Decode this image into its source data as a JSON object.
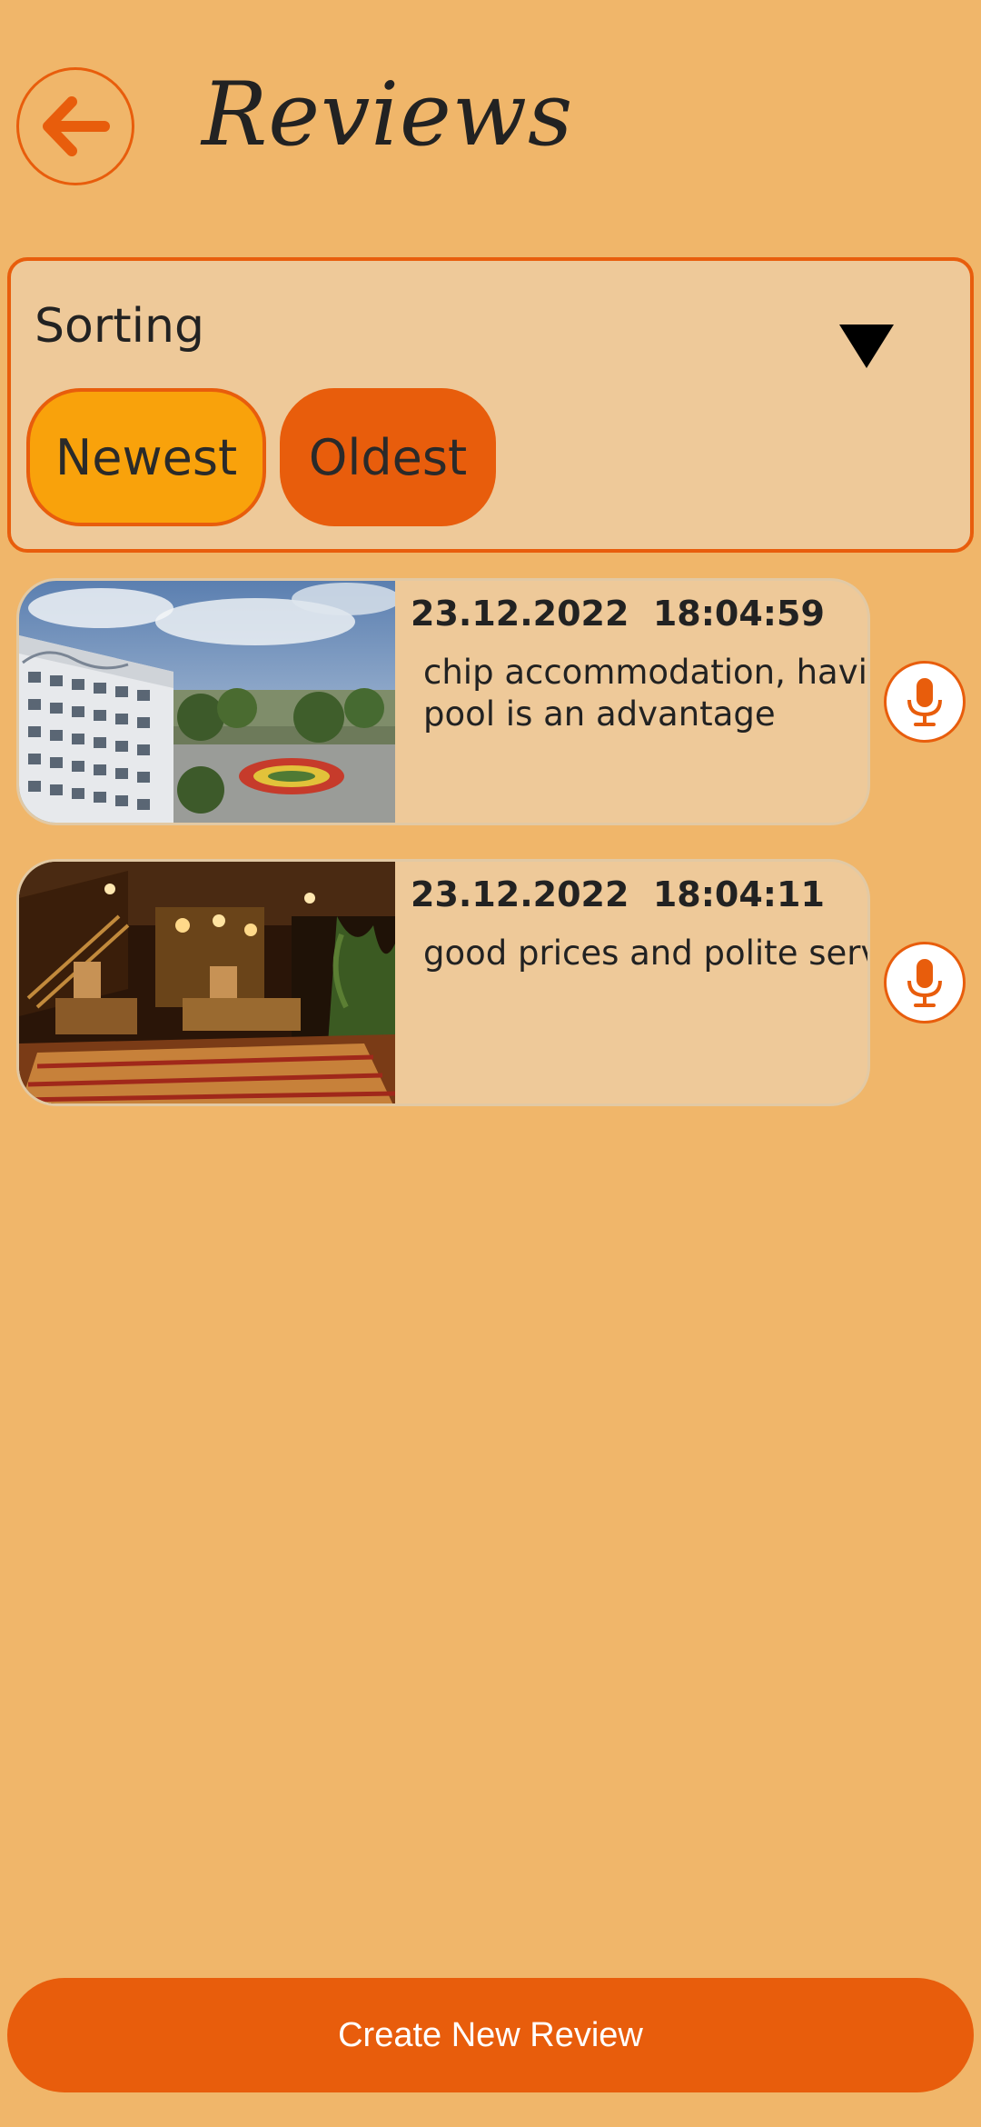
{
  "header": {
    "title": "Reviews",
    "back_icon": "arrow-left-icon"
  },
  "sorting": {
    "label": "Sorting",
    "dropdown_icon": "triangle-down-icon",
    "options": [
      {
        "label": "Newest",
        "selected": true
      },
      {
        "label": "Oldest",
        "selected": false
      }
    ]
  },
  "reviews": [
    {
      "date": "23.12.2022  18:04:59",
      "text_line1": "chip accommodation, having",
      "text_line2": "pool is an advantage",
      "image": "hotel-exterior-photo",
      "audio_icon": "microphone-icon"
    },
    {
      "date": "23.12.2022  18:04:11",
      "text_line1": "good prices and polite service",
      "text_line2": "",
      "image": "restaurant-interior-photo",
      "audio_icon": "microphone-icon"
    }
  ],
  "footer": {
    "create_label": "Create New Review"
  },
  "colors": {
    "background": "#F0B66A",
    "accent": "#E85D0C",
    "panel": "#EEC999",
    "selected_chip": "#F9A20B"
  }
}
